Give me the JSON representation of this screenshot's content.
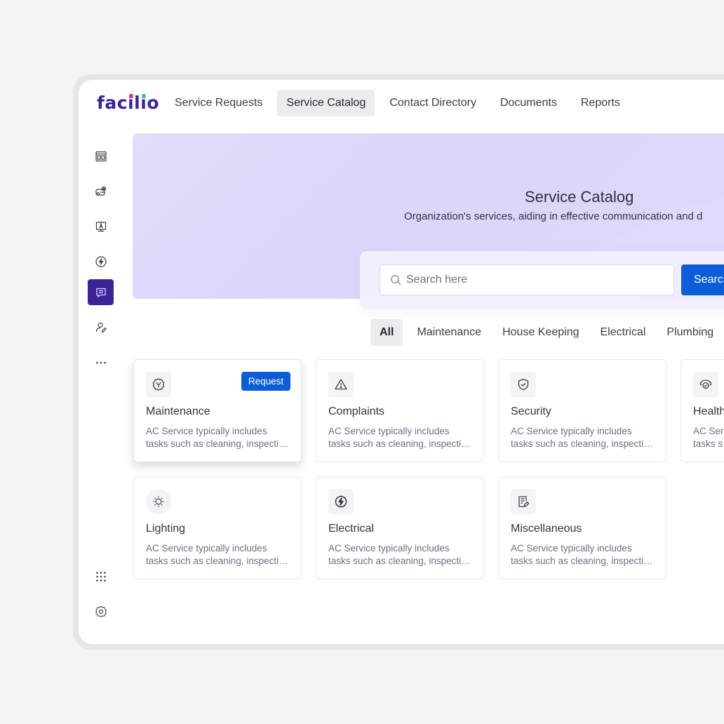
{
  "app": {
    "logo_text": "facilio",
    "logo_colors": {
      "primary": "#3c2396",
      "dot_pink": "#e5307b",
      "dot_teal": "#3fb6b8"
    }
  },
  "topnav": {
    "tabs": [
      {
        "label": "Service Requests",
        "active": false
      },
      {
        "label": "Service Catalog",
        "active": true
      },
      {
        "label": "Contact Directory",
        "active": false
      },
      {
        "label": "Documents",
        "active": false
      },
      {
        "label": "Reports",
        "active": false
      }
    ]
  },
  "sidebar": {
    "items": [
      {
        "icon": "dashboard-icon",
        "active": false
      },
      {
        "icon": "assets-icon",
        "active": false
      },
      {
        "icon": "visitor-icon",
        "active": false
      },
      {
        "icon": "energy-icon",
        "active": false
      },
      {
        "icon": "chat-icon",
        "active": true
      },
      {
        "icon": "user-edit-icon",
        "active": false
      },
      {
        "icon": "more-horizontal-icon",
        "active": false
      }
    ],
    "bottom_items": [
      {
        "icon": "apps-grid-icon"
      },
      {
        "icon": "settings-icon"
      }
    ],
    "active_color": "#3c2396"
  },
  "banner": {
    "title": "Service Catalog",
    "subtitle": "Organization's services, aiding in effective communication and d"
  },
  "search": {
    "placeholder": "Search here",
    "value": "",
    "button_label": "Searc"
  },
  "filters": [
    {
      "label": "All",
      "active": true
    },
    {
      "label": "Maintenance",
      "active": false
    },
    {
      "label": "House Keeping",
      "active": false
    },
    {
      "label": "Electrical",
      "active": false
    },
    {
      "label": "Plumbing",
      "active": false
    }
  ],
  "cards": [
    {
      "title": "Maintenance",
      "icon": "wrench-gear-icon",
      "desc_line1": "AC Service typically includes",
      "desc_line2": "tasks such as cleaning, inspecti…",
      "request_label": "Request",
      "hovered": true
    },
    {
      "title": "Complaints",
      "icon": "warning-icon",
      "desc_line1": "AC Service typically includes",
      "desc_line2": "tasks such as cleaning, inspecti…"
    },
    {
      "title": "Security",
      "icon": "shield-check-icon",
      "desc_line1": "AC Service typically includes",
      "desc_line2": "tasks such as cleaning, inspecti…"
    },
    {
      "title": "Health",
      "icon": "health-icon",
      "desc_line1": "AC Serv",
      "desc_line2": "tasks s"
    },
    {
      "title": "Lighting",
      "icon": "sun-icon",
      "desc_line1": "AC Service typically includes",
      "desc_line2": "tasks such as cleaning, inspecti…"
    },
    {
      "title": "Electrical",
      "icon": "lightning-icon",
      "desc_line1": "AC Service typically includes",
      "desc_line2": "tasks such as cleaning, inspecti…"
    },
    {
      "title": "Miscellaneous",
      "icon": "note-edit-icon",
      "desc_line1": "AC Service typically includes",
      "desc_line2": "tasks such as cleaning, inspecti…"
    }
  ],
  "colors": {
    "primary_button": "#0b5ed7",
    "banner": "#e0d9fb"
  }
}
